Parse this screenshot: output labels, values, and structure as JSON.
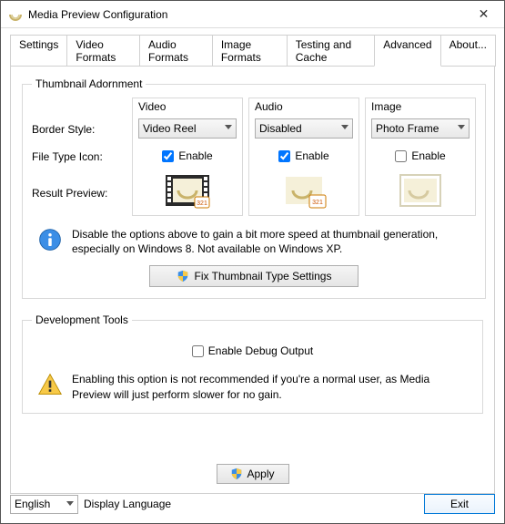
{
  "window": {
    "title": "Media Preview Configuration"
  },
  "tabs": {
    "t0": "Settings",
    "t1": "Video Formats",
    "t2": "Audio Formats",
    "t3": "Image Formats",
    "t4": "Testing and Cache",
    "t5": "Advanced",
    "t6": "About..."
  },
  "adorn": {
    "legend": "Thumbnail Adornment",
    "labels": {
      "border": "Border Style:",
      "icon": "File Type Icon:",
      "preview": "Result Preview:"
    },
    "cols": {
      "video": {
        "head": "Video",
        "dd": "Video Reel",
        "enable": "Enable"
      },
      "audio": {
        "head": "Audio",
        "dd": "Disabled",
        "enable": "Enable"
      },
      "image": {
        "head": "Image",
        "dd": "Photo Frame",
        "enable": "Enable"
      }
    },
    "info": "Disable the options above to gain a bit more speed at thumbnail generation, especially on Windows 8. Not available on Windows XP.",
    "fixbtn": "Fix Thumbnail Type Settings"
  },
  "dev": {
    "legend": "Development Tools",
    "debug": "Enable Debug Output",
    "warn": "Enabling this option is not recommended if you're a normal user, as Media Preview will just perform slower for no gain."
  },
  "apply": "Apply",
  "bottom": {
    "lang": "English",
    "langlabel": "Display Language",
    "exit": "Exit"
  }
}
